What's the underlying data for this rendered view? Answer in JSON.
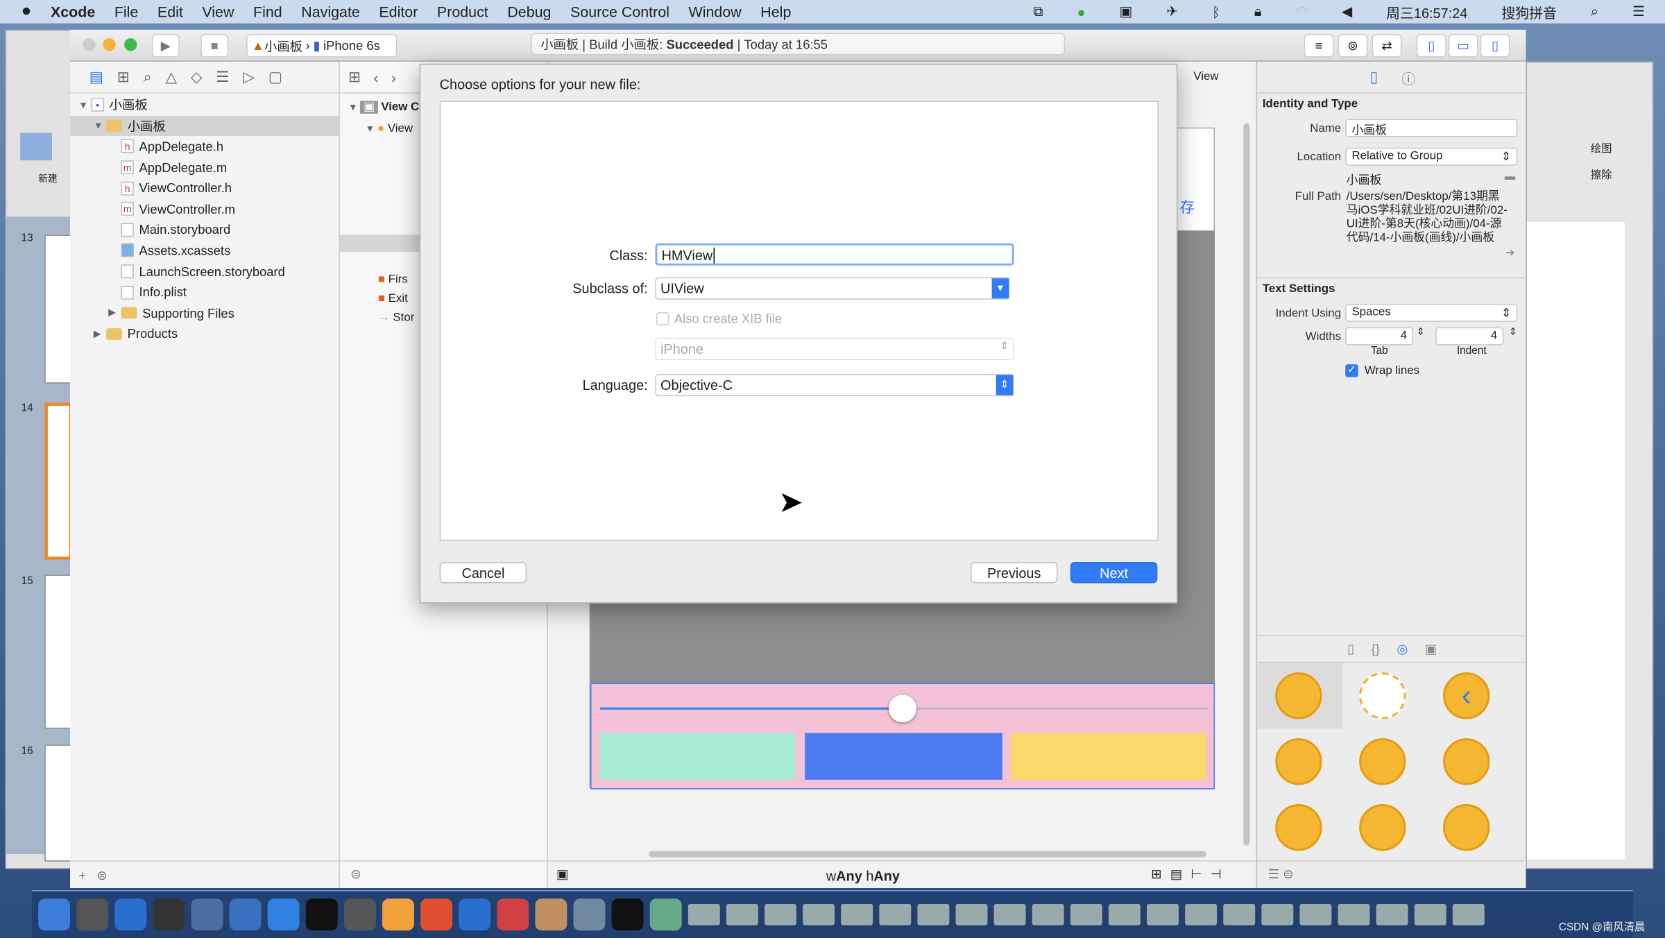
{
  "menubar": {
    "apple": "",
    "app": "Xcode",
    "items": [
      "File",
      "Edit",
      "View",
      "Find",
      "Navigate",
      "Editor",
      "Product",
      "Debug",
      "Source Control",
      "Window",
      "Help"
    ],
    "clock": "周三16:57:24",
    "input_method": "搜狗拼音"
  },
  "toolbar": {
    "scheme": "小画板",
    "device": "iPhone 6s",
    "activity": {
      "project": "小画板",
      "build": "Build 小画板:",
      "result": "Succeeded",
      "time": "Today at 16:55"
    }
  },
  "navigator": {
    "items": [
      {
        "label": "小画板",
        "type": "project",
        "level": 0
      },
      {
        "label": "小画板",
        "type": "group",
        "level": 1,
        "selected": true
      },
      {
        "label": "AppDelegate.h",
        "type": "h",
        "level": 2
      },
      {
        "label": "AppDelegate.m",
        "type": "m",
        "level": 2
      },
      {
        "label": "ViewController.h",
        "type": "h",
        "level": 2
      },
      {
        "label": "ViewController.m",
        "type": "m",
        "level": 2
      },
      {
        "label": "Main.storyboard",
        "type": "storyboard",
        "level": 2
      },
      {
        "label": "Assets.xcassets",
        "type": "assets",
        "level": 2
      },
      {
        "label": "LaunchScreen.storyboard",
        "type": "storyboard",
        "level": 2
      },
      {
        "label": "Info.plist",
        "type": "plist",
        "level": 2
      },
      {
        "label": "Supporting Files",
        "type": "group",
        "level": 2
      },
      {
        "label": "Products",
        "type": "group",
        "level": 1
      }
    ]
  },
  "outline": {
    "items": [
      "View C",
      "View",
      "Firs",
      "Exit",
      "Stor"
    ]
  },
  "canvas": {
    "view_label": "View",
    "save_fragment": "存",
    "size_class_w": "Any",
    "size_class_h": "Any",
    "w_prefix": "w",
    "h_prefix": "h",
    "colors": {
      "top": "#8e8e8e",
      "bottom": "#f4c1d6",
      "green": "#a8ecd6",
      "blue": "#4a7cf0",
      "yellow": "#fcd96a"
    },
    "slider_value": 0.5
  },
  "dialog": {
    "title": "Choose options for your new file:",
    "class_label": "Class:",
    "class_value": "HMView",
    "subclass_label": "Subclass of:",
    "subclass_value": "UIView",
    "xib_label": "Also create XIB file",
    "device_value": "iPhone",
    "language_label": "Language:",
    "language_value": "Objective-C",
    "cancel": "Cancel",
    "previous": "Previous",
    "next": "Next"
  },
  "inspector": {
    "identity_title": "Identity and Type",
    "name_label": "Name",
    "name_value": "小画板",
    "location_label": "Location",
    "location_value": "Relative to Group",
    "location_path": "小画板",
    "fullpath_label": "Full Path",
    "fullpath_value": "/Users/sen/Desktop/第13期黑马iOS学科就业班/02UI进阶/02-UI进阶-第8天(核心动画)/04-源代码/14-小画板(画线)/小画板",
    "text_title": "Text Settings",
    "indent_label": "Indent Using",
    "indent_value": "Spaces",
    "widths_label": "Widths",
    "tab_value": "4",
    "indent_width_value": "4",
    "tab_caption": "Tab",
    "indent_caption": "Indent",
    "wrap_label": "Wrap lines",
    "wrap_checked": true
  },
  "background_window": {
    "left_label": "新建",
    "right_labels": [
      "绘图",
      "擦除"
    ],
    "slide_numbers": [
      "13",
      "14",
      "15",
      "16"
    ]
  },
  "watermark": "CSDN @南风清晨",
  "accent": "#2f7cf6"
}
